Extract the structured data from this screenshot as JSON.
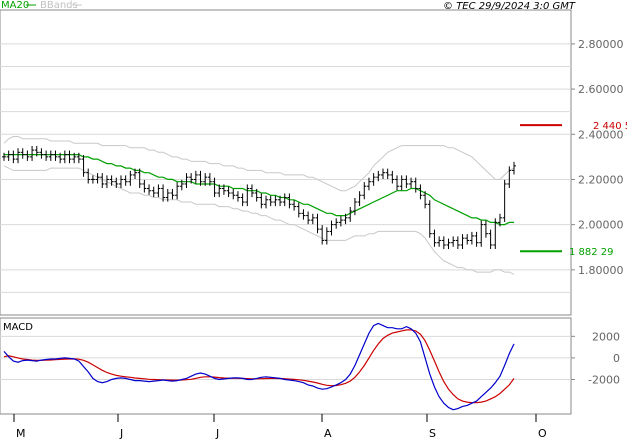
{
  "header": {
    "legend_ma20": "MA20",
    "legend_bbands": "BBands",
    "copyright": "© TEC 29/9/2024 3:0 GMT"
  },
  "colors": {
    "ma20": "#00a000",
    "bbands": "#c8c8c8",
    "price": "#000000",
    "macd": "#0000cc",
    "signal": "#cc0000",
    "target_high": "#cc0000",
    "target_low": "#00a000",
    "grid": "#d9d9d9"
  },
  "chart_data": [
    {
      "type": "ohlc",
      "title": "",
      "x_months": [
        "M",
        "J",
        "J",
        "A",
        "S",
        "O"
      ],
      "y_ticks": [
        "1.80000",
        "2.00000",
        "2.20000",
        "2.40000",
        "2.60000",
        "2.80000"
      ],
      "ylim": [
        1.6,
        2.95
      ],
      "price_label": "2 440 5",
      "support_label": "1 882 29",
      "price_level": 2.4405,
      "support_level": 1.8823,
      "close": [
        2.3,
        2.31,
        2.29,
        2.32,
        2.31,
        2.3,
        2.33,
        2.32,
        2.31,
        2.3,
        2.31,
        2.3,
        2.29,
        2.31,
        2.29,
        2.3,
        2.29,
        2.23,
        2.2,
        2.2,
        2.21,
        2.18,
        2.2,
        2.19,
        2.18,
        2.2,
        2.19,
        2.22,
        2.23,
        2.18,
        2.16,
        2.15,
        2.14,
        2.16,
        2.12,
        2.14,
        2.13,
        2.17,
        2.18,
        2.21,
        2.2,
        2.22,
        2.19,
        2.21,
        2.19,
        2.14,
        2.16,
        2.15,
        2.14,
        2.13,
        2.12,
        2.1,
        2.16,
        2.14,
        2.12,
        2.09,
        2.11,
        2.1,
        2.11,
        2.1,
        2.12,
        2.09,
        2.08,
        2.05,
        2.04,
        2.02,
        2.03,
        1.98,
        1.93,
        1.97,
        2.0,
        2.01,
        2.02,
        2.03,
        2.06,
        2.1,
        2.13,
        2.17,
        2.19,
        2.21,
        2.22,
        2.23,
        2.22,
        2.2,
        2.17,
        2.2,
        2.18,
        2.19,
        2.16,
        2.13,
        2.09,
        1.96,
        1.92,
        1.93,
        1.91,
        1.92,
        1.93,
        1.91,
        1.94,
        1.93,
        1.95,
        1.92,
        2.0,
        1.96,
        1.91,
        2.01,
        2.03,
        2.18,
        2.24,
        2.26
      ],
      "ma20": [
        2.31,
        2.31,
        2.31,
        2.31,
        2.31,
        2.31,
        2.31,
        2.31,
        2.31,
        2.31,
        2.31,
        2.31,
        2.31,
        2.31,
        2.31,
        2.31,
        2.31,
        2.3,
        2.3,
        2.29,
        2.29,
        2.28,
        2.27,
        2.27,
        2.26,
        2.26,
        2.25,
        2.25,
        2.24,
        2.24,
        2.23,
        2.23,
        2.22,
        2.21,
        2.21,
        2.2,
        2.2,
        2.19,
        2.19,
        2.19,
        2.19,
        2.18,
        2.18,
        2.18,
        2.18,
        2.18,
        2.17,
        2.17,
        2.17,
        2.16,
        2.16,
        2.16,
        2.15,
        2.15,
        2.15,
        2.14,
        2.14,
        2.13,
        2.13,
        2.12,
        2.12,
        2.11,
        2.11,
        2.1,
        2.09,
        2.09,
        2.08,
        2.07,
        2.06,
        2.05,
        2.05,
        2.04,
        2.04,
        2.04,
        2.05,
        2.06,
        2.07,
        2.08,
        2.09,
        2.1,
        2.11,
        2.12,
        2.13,
        2.14,
        2.15,
        2.15,
        2.15,
        2.16,
        2.16,
        2.15,
        2.14,
        2.13,
        2.11,
        2.1,
        2.09,
        2.08,
        2.07,
        2.06,
        2.05,
        2.04,
        2.03,
        2.03,
        2.02,
        2.02,
        2.01,
        2.01,
        2.0,
        2.0,
        2.01,
        2.01
      ],
      "bb_upper": [
        2.36,
        2.38,
        2.39,
        2.39,
        2.38,
        2.38,
        2.38,
        2.38,
        2.38,
        2.38,
        2.37,
        2.37,
        2.37,
        2.37,
        2.37,
        2.36,
        2.36,
        2.36,
        2.36,
        2.36,
        2.36,
        2.35,
        2.35,
        2.35,
        2.35,
        2.35,
        2.35,
        2.34,
        2.34,
        2.34,
        2.34,
        2.33,
        2.33,
        2.32,
        2.32,
        2.31,
        2.3,
        2.3,
        2.29,
        2.29,
        2.28,
        2.28,
        2.28,
        2.28,
        2.27,
        2.27,
        2.27,
        2.26,
        2.26,
        2.26,
        2.25,
        2.25,
        2.24,
        2.24,
        2.24,
        2.24,
        2.23,
        2.23,
        2.23,
        2.23,
        2.22,
        2.22,
        2.22,
        2.22,
        2.22,
        2.21,
        2.21,
        2.2,
        2.19,
        2.18,
        2.17,
        2.16,
        2.15,
        2.15,
        2.16,
        2.17,
        2.19,
        2.21,
        2.23,
        2.26,
        2.28,
        2.3,
        2.32,
        2.33,
        2.34,
        2.35,
        2.35,
        2.35,
        2.35,
        2.35,
        2.35,
        2.35,
        2.35,
        2.35,
        2.35,
        2.34,
        2.34,
        2.33,
        2.32,
        2.31,
        2.3,
        2.28,
        2.26,
        2.24,
        2.22,
        2.2,
        2.2,
        2.22,
        2.24,
        2.25
      ],
      "bb_lower": [
        2.26,
        2.25,
        2.24,
        2.24,
        2.24,
        2.24,
        2.24,
        2.24,
        2.24,
        2.24,
        2.25,
        2.25,
        2.25,
        2.25,
        2.25,
        2.25,
        2.25,
        2.24,
        2.23,
        2.22,
        2.21,
        2.2,
        2.19,
        2.18,
        2.17,
        2.16,
        2.15,
        2.14,
        2.14,
        2.14,
        2.13,
        2.13,
        2.12,
        2.12,
        2.11,
        2.11,
        2.11,
        2.11,
        2.1,
        2.1,
        2.1,
        2.09,
        2.09,
        2.09,
        2.09,
        2.09,
        2.08,
        2.08,
        2.08,
        2.07,
        2.07,
        2.06,
        2.06,
        2.05,
        2.05,
        2.04,
        2.04,
        2.03,
        2.02,
        2.02,
        2.01,
        2.0,
        2.0,
        1.99,
        1.98,
        1.97,
        1.96,
        1.95,
        1.94,
        1.93,
        1.93,
        1.93,
        1.93,
        1.93,
        1.94,
        1.95,
        1.95,
        1.95,
        1.96,
        1.96,
        1.97,
        1.97,
        1.97,
        1.97,
        1.97,
        1.97,
        1.97,
        1.97,
        1.97,
        1.96,
        1.94,
        1.91,
        1.88,
        1.86,
        1.84,
        1.83,
        1.82,
        1.81,
        1.81,
        1.8,
        1.8,
        1.79,
        1.79,
        1.79,
        1.79,
        1.8,
        1.8,
        1.79,
        1.79,
        1.78
      ]
    },
    {
      "type": "line",
      "title": "MACD",
      "y_ticks": [
        "2000",
        "0",
        "-2000"
      ],
      "ylim": [
        -5200,
        3700
      ],
      "series": [
        {
          "values": [
            600,
            100,
            -300,
            -400,
            -250,
            -200,
            -250,
            -300,
            -200,
            -150,
            -100,
            -100,
            -50,
            0,
            -50,
            -100,
            -300,
            -800,
            -1300,
            -1900,
            -2200,
            -2300,
            -2200,
            -2000,
            -1900,
            -1850,
            -1900,
            -2000,
            -2100,
            -2100,
            -2150,
            -2200,
            -2150,
            -2100,
            -2050,
            -2100,
            -2150,
            -2100,
            -2000,
            -1900,
            -1700,
            -1500,
            -1400,
            -1500,
            -1700,
            -1900,
            -2000,
            -1950,
            -1900,
            -1850,
            -1850,
            -1900,
            -2000,
            -2000,
            -1900,
            -1800,
            -1750,
            -1800,
            -1850,
            -1900,
            -2000,
            -2050,
            -2100,
            -2200,
            -2300,
            -2500,
            -2600,
            -2800,
            -2900,
            -2850,
            -2700,
            -2500,
            -2300,
            -2000,
            -1500,
            -700,
            300,
            1300,
            2300,
            3000,
            3200,
            3000,
            2800,
            2800,
            2700,
            2700,
            2900,
            2700,
            2300,
            1500,
            0,
            -1500,
            -2700,
            -3600,
            -4200,
            -4600,
            -4800,
            -4700,
            -4500,
            -4400,
            -4200,
            -4000,
            -3600,
            -3200,
            -2800,
            -2300,
            -1700,
            -700,
            400,
            1300
          ]
        },
        {
          "values": [
            100,
            200,
            100,
            0,
            -100,
            -150,
            -200,
            -220,
            -220,
            -210,
            -190,
            -170,
            -140,
            -110,
            -100,
            -90,
            -120,
            -220,
            -400,
            -650,
            -900,
            -1150,
            -1350,
            -1500,
            -1620,
            -1700,
            -1750,
            -1800,
            -1860,
            -1900,
            -1940,
            -1980,
            -2000,
            -2020,
            -2040,
            -2050,
            -2060,
            -2060,
            -2050,
            -2020,
            -1980,
            -1900,
            -1800,
            -1750,
            -1750,
            -1780,
            -1830,
            -1860,
            -1880,
            -1890,
            -1890,
            -1900,
            -1920,
            -1940,
            -1940,
            -1930,
            -1910,
            -1900,
            -1900,
            -1910,
            -1930,
            -1960,
            -1990,
            -2030,
            -2080,
            -2150,
            -2230,
            -2330,
            -2450,
            -2540,
            -2580,
            -2560,
            -2480,
            -2350,
            -2150,
            -1800,
            -1300,
            -700,
            0,
            700,
            1300,
            1800,
            2100,
            2300,
            2400,
            2500,
            2600,
            2600,
            2500,
            2200,
            1600,
            700,
            -300,
            -1300,
            -2200,
            -2900,
            -3400,
            -3800,
            -4000,
            -4100,
            -4150,
            -4150,
            -4100,
            -4000,
            -3800,
            -3600,
            -3300,
            -2900,
            -2500,
            -1900
          ]
        }
      ]
    }
  ]
}
